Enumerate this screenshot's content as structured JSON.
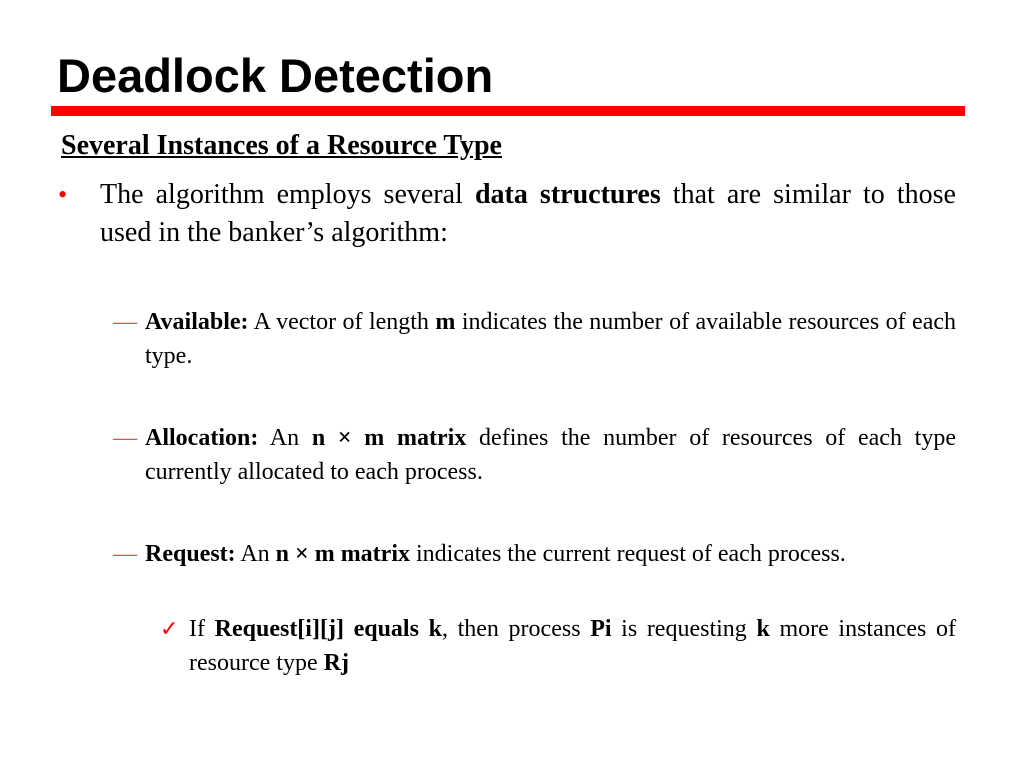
{
  "slide": {
    "title": "Deadlock Detection",
    "subtitle": "Several Instances of a Resource Type",
    "bullet": {
      "icon": "bullet-dot",
      "text_before": "The algorithm employs several ",
      "bold": "data structures",
      "text_after": " that are similar to those used in the banker’s algorithm:"
    },
    "items": [
      {
        "label": "Available:",
        "parts": [
          " A vector of length ",
          "m",
          " indicates the number of available resources of each type."
        ]
      },
      {
        "label": "Allocation:",
        "parts": [
          " An ",
          "n × m matrix",
          " defines the number of resources of each type currently allocated to each process."
        ]
      },
      {
        "label": "Request:",
        "parts": [
          " An ",
          "n × m matrix",
          " indicates the current request of each process."
        ]
      }
    ],
    "note": {
      "icon": "checkmark",
      "t1": "If ",
      "b1": "Request[i][j] equals k",
      "t2": ", then process ",
      "b2": "Pi",
      "t3": " is requesting ",
      "b3": "k",
      "t4": " more instances of resource type ",
      "b4": "Rj"
    },
    "dash_glyph": "—",
    "bullet_glyph": "•",
    "check_glyph": "✓",
    "accent_color": "#ff0000"
  }
}
